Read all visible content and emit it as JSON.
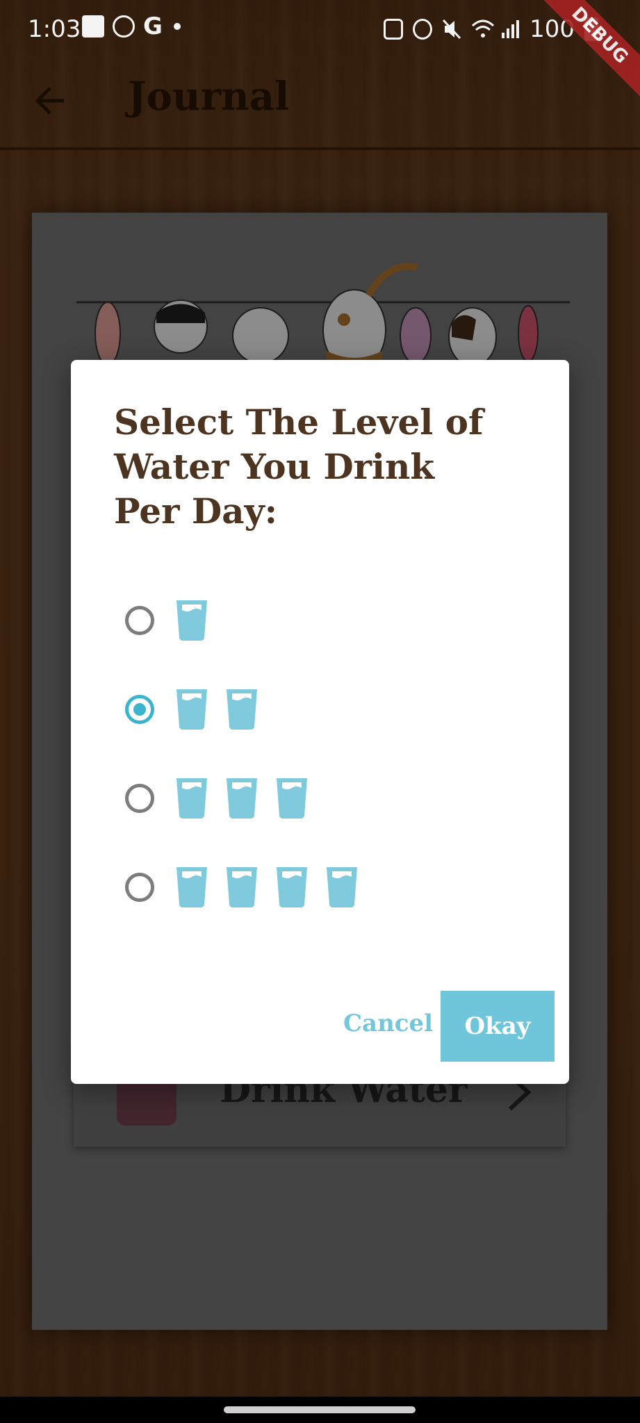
{
  "status_bar": {
    "time": "1:03",
    "left_icons": [
      "image-icon",
      "whatsapp-icon",
      "google-icon",
      "dot-icon"
    ],
    "right_icons": [
      "recycle-icon",
      "alarm-icon",
      "mute-icon",
      "wifi-icon",
      "signal-icon"
    ],
    "battery_text": "100",
    "battery_icon": "battery-icon"
  },
  "debug_banner": "DEBUG",
  "app_bar": {
    "back_icon": "arrow-left-icon",
    "title": "Journal"
  },
  "background_list": {
    "row_label": "Drink Water",
    "row_icon": "chevron-right-icon"
  },
  "dialog": {
    "title": "Select The Level of Water You Drink Per Day:",
    "options": [
      {
        "glasses": 1,
        "selected": false
      },
      {
        "glasses": 2,
        "selected": true
      },
      {
        "glasses": 3,
        "selected": false
      },
      {
        "glasses": 4,
        "selected": false
      }
    ],
    "cancel_label": "Cancel",
    "okay_label": "Okay"
  },
  "colors": {
    "accent": "#3ab5cd",
    "button": "#6fc6db",
    "title_text": "#4d3420",
    "glass": "#7ec9db"
  }
}
